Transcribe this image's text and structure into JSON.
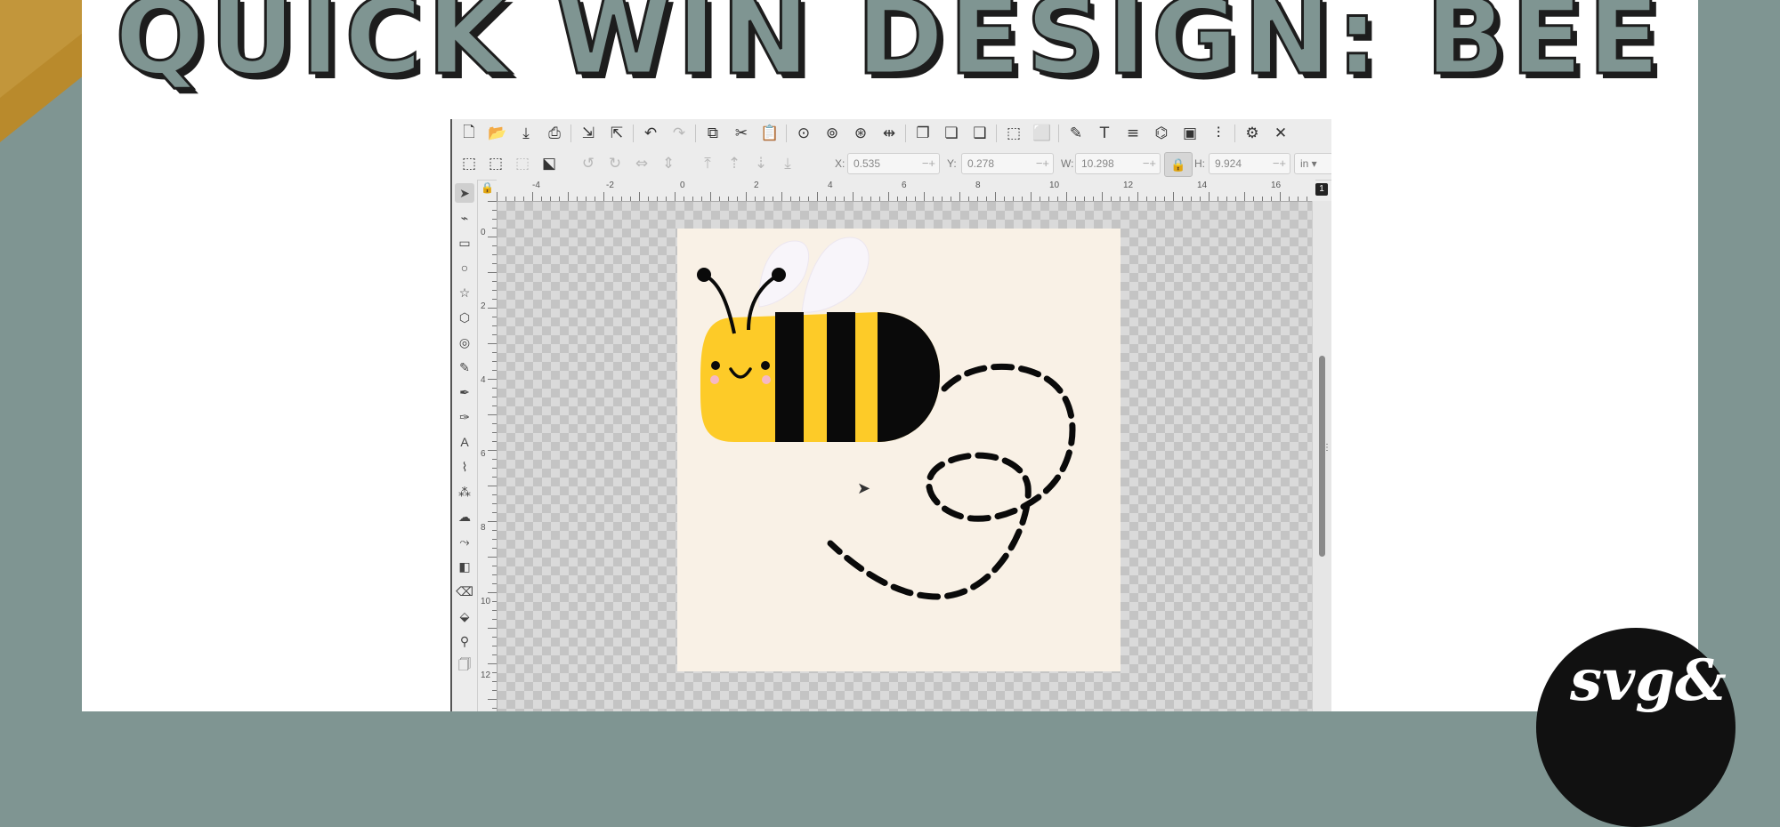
{
  "title": "QUICK WIN DESIGN: BEE",
  "logo_text": "svg&",
  "colors": {
    "sage": "#7f9592",
    "bee_yellow": "#fdcb28",
    "wing": "#f8f5fa",
    "page_bg": "#f9f1e6",
    "accent_gold": "#b98a2c"
  },
  "app": {
    "toolbar_top": [
      {
        "name": "new-document-icon",
        "glyph": "🗋",
        "enabled": true
      },
      {
        "name": "open-icon",
        "glyph": "📂",
        "enabled": true
      },
      {
        "name": "save-icon",
        "glyph": "⤓",
        "enabled": true
      },
      {
        "name": "print-icon",
        "glyph": "⎙",
        "enabled": true
      },
      {
        "name": "import-icon",
        "glyph": "⇲",
        "enabled": true
      },
      {
        "name": "export-icon",
        "glyph": "⇱",
        "enabled": true
      },
      {
        "name": "undo-icon",
        "glyph": "↶",
        "enabled": true
      },
      {
        "name": "redo-icon",
        "glyph": "↷",
        "enabled": false
      },
      {
        "name": "copy-icon",
        "glyph": "⧉",
        "enabled": true
      },
      {
        "name": "cut-icon",
        "glyph": "✂",
        "enabled": true
      },
      {
        "name": "paste-icon",
        "glyph": "📋",
        "enabled": true
      },
      {
        "name": "zoom-selection-icon",
        "glyph": "⊙",
        "enabled": true
      },
      {
        "name": "zoom-drawing-icon",
        "glyph": "⊚",
        "enabled": true
      },
      {
        "name": "zoom-page-icon",
        "glyph": "⊛",
        "enabled": true
      },
      {
        "name": "zoom-width-icon",
        "glyph": "⇹",
        "enabled": true
      },
      {
        "name": "duplicate-icon",
        "glyph": "❐",
        "enabled": true
      },
      {
        "name": "clone-icon",
        "glyph": "❏",
        "enabled": true
      },
      {
        "name": "unlink-clone-icon",
        "glyph": "❑",
        "enabled": true
      },
      {
        "name": "group-icon",
        "glyph": "⬚",
        "enabled": true
      },
      {
        "name": "ungroup-icon",
        "glyph": "⬜",
        "enabled": true
      },
      {
        "name": "fill-stroke-icon",
        "glyph": "✎",
        "enabled": true
      },
      {
        "name": "text-font-icon",
        "glyph": "T",
        "enabled": true
      },
      {
        "name": "layers-icon",
        "glyph": "≡",
        "enabled": true
      },
      {
        "name": "xml-editor-icon",
        "glyph": "⌬",
        "enabled": true
      },
      {
        "name": "object-list-icon",
        "glyph": "▣",
        "enabled": true
      },
      {
        "name": "align-distribute-icon",
        "glyph": "⫶",
        "enabled": true
      },
      {
        "name": "preferences-icon",
        "glyph": "⚙",
        "enabled": true
      },
      {
        "name": "close-panel-icon",
        "glyph": "✕",
        "enabled": true
      }
    ],
    "toolbar_select": [
      {
        "name": "select-all-icon",
        "glyph": "⬚",
        "enabled": true
      },
      {
        "name": "select-all-layers-icon",
        "glyph": "⬚",
        "enabled": true
      },
      {
        "name": "deselect-icon",
        "glyph": "⬚",
        "enabled": false
      },
      {
        "name": "transform-handles-icon",
        "glyph": "⬕",
        "enabled": true
      },
      {
        "name": "rotate-ccw-icon",
        "glyph": "↺",
        "enabled": false
      },
      {
        "name": "rotate-cw-icon",
        "glyph": "↻",
        "enabled": false
      },
      {
        "name": "flip-horizontal-icon",
        "glyph": "⇔",
        "enabled": false
      },
      {
        "name": "flip-vertical-icon",
        "glyph": "⇕",
        "enabled": false
      },
      {
        "name": "raise-top-icon",
        "glyph": "⤒",
        "enabled": false
      },
      {
        "name": "raise-icon",
        "glyph": "⇡",
        "enabled": false
      },
      {
        "name": "lower-icon",
        "glyph": "⇣",
        "enabled": false
      },
      {
        "name": "lower-bottom-icon",
        "glyph": "⤓",
        "enabled": false
      }
    ],
    "fields": {
      "x": {
        "label": "X:",
        "value": "0.535"
      },
      "y": {
        "label": "Y:",
        "value": "0.278"
      },
      "w": {
        "label": "W:",
        "value": "10.298"
      },
      "h": {
        "label": "H:",
        "value": "9.924"
      },
      "units": "in"
    },
    "tools": [
      {
        "name": "selector-tool-icon",
        "glyph": "➤"
      },
      {
        "name": "node-tool-icon",
        "glyph": "⌁"
      },
      {
        "name": "rectangle-tool-icon",
        "glyph": "▭"
      },
      {
        "name": "circle-tool-icon",
        "glyph": "○"
      },
      {
        "name": "star-tool-icon",
        "glyph": "☆"
      },
      {
        "name": "3d-box-tool-icon",
        "glyph": "⬡"
      },
      {
        "name": "spiral-tool-icon",
        "glyph": "◎"
      },
      {
        "name": "pencil-tool-icon",
        "glyph": "✎"
      },
      {
        "name": "pen-tool-icon",
        "glyph": "✒"
      },
      {
        "name": "calligraphy-tool-icon",
        "glyph": "✑"
      },
      {
        "name": "text-tool-icon",
        "glyph": "A"
      },
      {
        "name": "dropper-tool-icon",
        "glyph": "⌇"
      },
      {
        "name": "spray-tool-icon",
        "glyph": "⁂"
      },
      {
        "name": "tweak-tool-icon",
        "glyph": "☁"
      },
      {
        "name": "connector-tool-icon",
        "glyph": "⤳"
      },
      {
        "name": "gradient-tool-icon",
        "glyph": "◧"
      },
      {
        "name": "eraser-tool-icon",
        "glyph": "⌫"
      },
      {
        "name": "paint-bucket-tool-icon",
        "glyph": "⬙"
      },
      {
        "name": "zoom-tool-icon",
        "glyph": "⚲"
      },
      {
        "name": "pages-tool-icon",
        "glyph": "🗍"
      }
    ],
    "ruler_top": [
      "-4",
      "-2",
      "0",
      "2",
      "4",
      "6",
      "8",
      "10",
      "12",
      "14",
      "16"
    ],
    "ruler_left": [
      "0",
      "2",
      "4",
      "6",
      "8",
      "10",
      "12"
    ],
    "page_badge": "1"
  }
}
